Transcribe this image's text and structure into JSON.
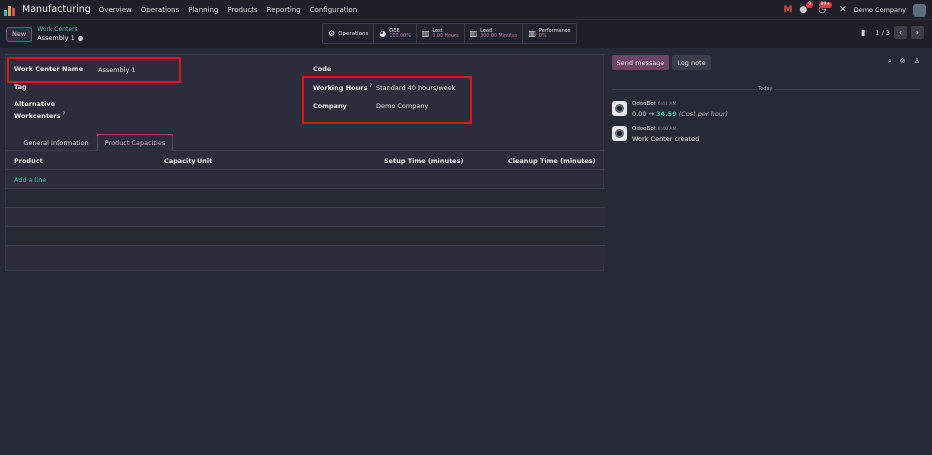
{
  "nav": {
    "app_title": "Manufacturing",
    "menu": [
      "Overview",
      "Operations",
      "Planning",
      "Products",
      "Reporting",
      "Configuration"
    ],
    "activity_badge": "9",
    "clock_badge": "99+",
    "company": "Demo Company"
  },
  "control": {
    "new_label": "New",
    "breadcrumb_parent": "Work Centers",
    "breadcrumb_current": "Assembly 1",
    "stats": {
      "operations": "Operations",
      "oee_label": "OEE",
      "oee_value": "100.00%",
      "lost_label": "Lost",
      "lost_value": "0.00 Hours",
      "load_label": "Load",
      "load_value": "300.00 Minutes",
      "performance_label": "Performance",
      "performance_value": "0%"
    },
    "pager": "1 / 3"
  },
  "form": {
    "work_center_name_label": "Work Center Name",
    "work_center_name_value": "Assembly 1",
    "tag_label": "Tag",
    "alternative_label_1": "Alternative",
    "alternative_label_2": "Workcenters",
    "code_label": "Code",
    "working_hours_label": "Working Hours",
    "working_hours_value": "Standard 40 hours/week",
    "company_label": "Company",
    "company_value": "Demo Company",
    "tabs": [
      "General Information",
      "Product Capacities"
    ],
    "columns": {
      "product": "Product",
      "capacity": "Capacity",
      "unit": "Unit",
      "setup": "Setup Time (minutes)",
      "cleanup": "Cleanup Time (minutes)"
    },
    "add_line": "Add a line",
    "help_mark": "?"
  },
  "chatter": {
    "send_message": "Send message",
    "log_note": "Log note",
    "today": "Today",
    "messages": [
      {
        "author": "OdooBot",
        "time": "6:41 AM",
        "old": "0.00",
        "arrow": "→",
        "new": "34.59",
        "field": "(Cost per hour)"
      },
      {
        "author": "OdooBot",
        "time": "6:40 AM",
        "body": "Work Center created"
      }
    ]
  },
  "colors": {
    "background": "#262A36",
    "accent": "#6E4466",
    "link": "#3FB8A8",
    "highlight": "#E0121B"
  }
}
